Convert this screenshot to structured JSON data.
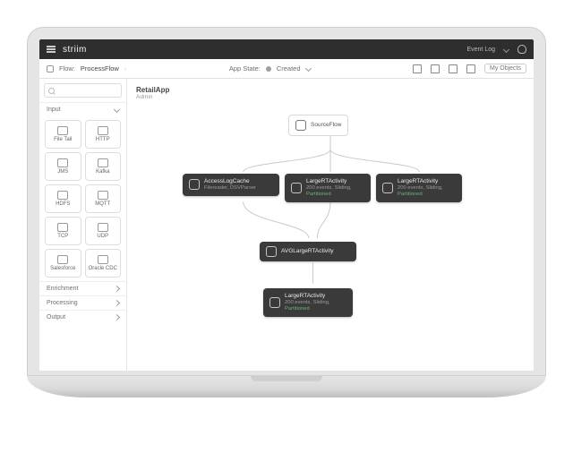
{
  "topbar": {
    "brand": "striim",
    "event_log": "Event Log"
  },
  "subbar": {
    "flow_label": "Flow:",
    "flow_name": "ProcessFlow",
    "app_state_label": "App State:",
    "app_state_value": "Created",
    "my_objects": "My Objects"
  },
  "sidebar": {
    "search_placeholder": "",
    "sections": {
      "input": "Input",
      "enrichment": "Enrichment",
      "processing": "Processing",
      "output": "Output"
    },
    "components": [
      {
        "label": "File Tail"
      },
      {
        "label": "HTTP"
      },
      {
        "label": "JMS"
      },
      {
        "label": "Kafka"
      },
      {
        "label": "HDFS"
      },
      {
        "label": "MQTT"
      },
      {
        "label": "TCP"
      },
      {
        "label": "UDP"
      },
      {
        "label": "Salesforce"
      },
      {
        "label": "Oracle CDC"
      }
    ]
  },
  "canvas": {
    "app_name": "RetailApp",
    "owner": "Admin",
    "nodes": {
      "source": {
        "title": "SourceFlow"
      },
      "cache": {
        "title": "AccessLogCache",
        "meta": "Filereader, DSVParser"
      },
      "act1": {
        "title": "LargeRTActivity",
        "meta": "200 events, Sliding,",
        "part": "Partitioned"
      },
      "act2": {
        "title": "LargeRTActivity",
        "meta": "200 events, Sliding,",
        "part": "Partitioned"
      },
      "cq": {
        "title": "AVGLargeRTActivity"
      },
      "act3": {
        "title": "LargeRTActivity",
        "meta": "200 events, Sliding,",
        "part": "Partitioned"
      }
    }
  }
}
